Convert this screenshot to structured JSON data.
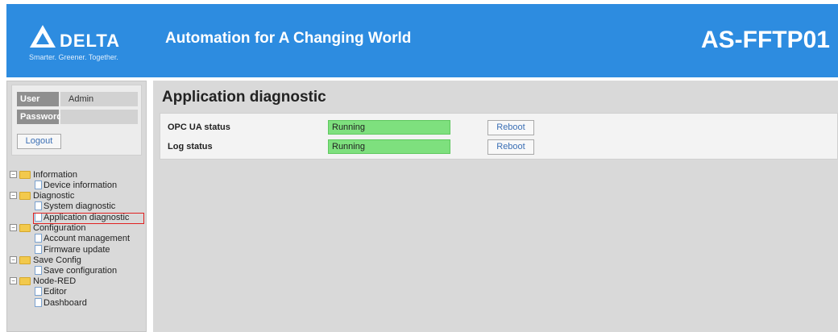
{
  "header": {
    "brand": "DELTA",
    "tagline": "Smarter. Greener. Together.",
    "slogan": "Automation for A Changing World",
    "model": "AS-FFTP01",
    "color": "#2d8ce0"
  },
  "login": {
    "user_label": "User",
    "user_value": "Admin",
    "password_label": "Password",
    "password_value": "",
    "logout_label": "Logout"
  },
  "nav": {
    "information": "Information",
    "device_information": "Device information",
    "diagnostic": "Diagnostic",
    "system_diagnostic": "System diagnostic",
    "application_diagnostic": "Application diagnostic",
    "configuration": "Configuration",
    "account_management": "Account management",
    "firmware_update": "Firmware update",
    "save_config": "Save Config",
    "save_configuration": "Save configuration",
    "node_red": "Node-RED",
    "editor": "Editor",
    "dashboard": "Dashboard",
    "selected": "Application diagnostic"
  },
  "main": {
    "title": "Application diagnostic",
    "rows": [
      {
        "label": "OPC UA status",
        "value": "Running",
        "action": "Reboot"
      },
      {
        "label": "Log status",
        "value": "Running",
        "action": "Reboot"
      }
    ],
    "running_color": "#7ee07e"
  }
}
